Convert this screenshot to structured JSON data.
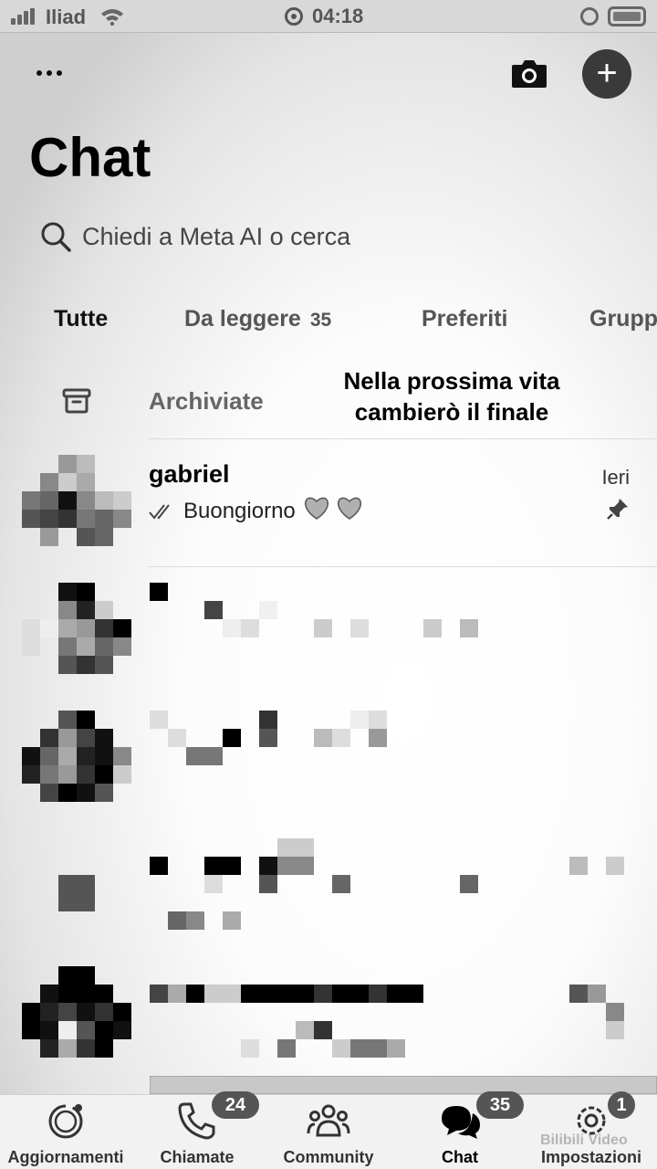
{
  "status_bar": {
    "carrier": "Iliad",
    "time": "04:18",
    "icons": [
      "signal-icon",
      "wifi-icon",
      "timer-icon",
      "orientation-lock-icon",
      "battery-icon"
    ]
  },
  "header": {
    "title": "Chat",
    "more_icon": "more-horizontal-icon",
    "camera_icon": "camera-icon",
    "new_chat_icon": "plus-icon"
  },
  "search": {
    "placeholder": "Chiedi a Meta AI o cerca",
    "icon": "search-icon"
  },
  "filters": {
    "tabs": [
      {
        "label": "Tutte",
        "active": true
      },
      {
        "label": "Da leggere",
        "count": "35"
      },
      {
        "label": "Preferiti"
      },
      {
        "label": "Grupp"
      }
    ]
  },
  "archived": {
    "label": "Archiviate",
    "icon": "archive-icon"
  },
  "overlay_caption": {
    "line1": "Nella prossima vita",
    "line2": "cambierò il finale"
  },
  "chats": [
    {
      "name": "gabriel",
      "preview": "Buongiorno",
      "preview_emoji": "🩶🩶",
      "time": "Ieri",
      "pinned": true,
      "read_status": "double-check-icon"
    }
  ],
  "redacted_chat_count": 4,
  "bottom_nav": {
    "items": [
      {
        "label": "Aggiornamenti",
        "icon": "status-icon"
      },
      {
        "label": "Chiamate",
        "icon": "phone-icon",
        "badge": "24"
      },
      {
        "label": "Community",
        "icon": "community-icon"
      },
      {
        "label": "Chat",
        "icon": "chat-bubbles-icon",
        "badge": "35",
        "active": true
      },
      {
        "label": "Impostazioni",
        "icon": "gear-icon",
        "badge": "1"
      }
    ]
  },
  "watermark": "Bilibili Video"
}
